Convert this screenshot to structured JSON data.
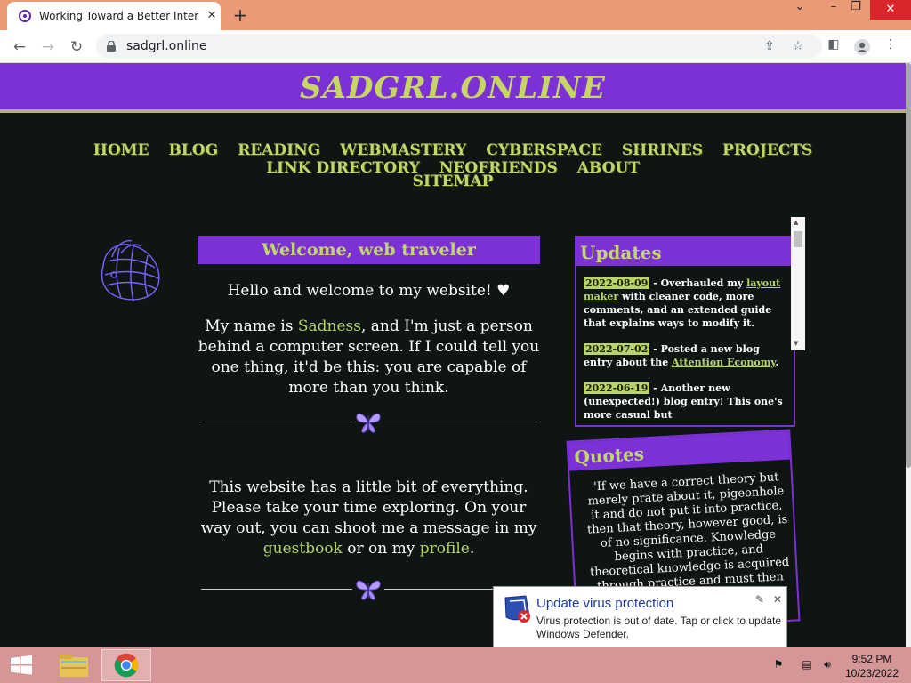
{
  "browser": {
    "tab_title": "Working Toward a Better Internet",
    "url": "sadgrl.online",
    "tab_close": "✕",
    "new_tab": "+"
  },
  "site": {
    "logo": "SADGRL.ONLINE",
    "nav": [
      "HOME",
      "BLOG",
      "READING",
      "WEBMASTERY",
      "CYBERSPACE",
      "SHRINES",
      "PROJECTS",
      "LINK DIRECTORY",
      "NEOFRIENDS",
      "ABOUT"
    ],
    "nav_row2": [
      "SITEMAP"
    ]
  },
  "welcome": {
    "heading": "Welcome, web traveler",
    "greeting": "Hello and welcome to my website! ♥",
    "intro_1": "My name is ",
    "name": "Sadness",
    "intro_2": ", and I'm just a person behind a computer screen. If I could tell you one thing, it'd be this: you are capable of more than you think.",
    "p2_1": "This website has a little bit of everything. Please take your time exploring. On your way out, you can shoot me a message in my ",
    "guestbook": "guestbook",
    "p2_2": " or on my ",
    "profile": "profile",
    "p2_3": "."
  },
  "updates": {
    "heading": "Updates",
    "items": [
      {
        "date": "2022-08-09",
        "pre": " - Overhauled my ",
        "link": "layout maker",
        "post": " with cleaner code, more comments, and an extended guide that explains ways to modify it."
      },
      {
        "date": "2022-07-02",
        "pre": " - Posted a new blog entry about the ",
        "link": "Attention Economy",
        "post": "."
      },
      {
        "date": "2022-06-19",
        "pre": " - Another new (unexpected!) blog entry! This one's more casual but",
        "link": "",
        "post": ""
      }
    ]
  },
  "quotes": {
    "heading": "Quotes",
    "text": "\"If we have a correct theory but merely prate about it, pigeonhole it and do not put it into practice, then that theory, however good, is of no significance. Knowledge begins with practice, and theoretical knowledge is acquired through practice and must then return to practice.\""
  },
  "toast": {
    "title": "Update virus protection",
    "body": "Virus protection is out of date. Tap or click to update Windows Defender."
  },
  "taskbar": {
    "time": "9:52 PM",
    "date": "10/23/2022"
  },
  "colors": {
    "accent_purple": "#7c31d6",
    "accent_green": "#c2d66a",
    "background": "#0f1513"
  }
}
